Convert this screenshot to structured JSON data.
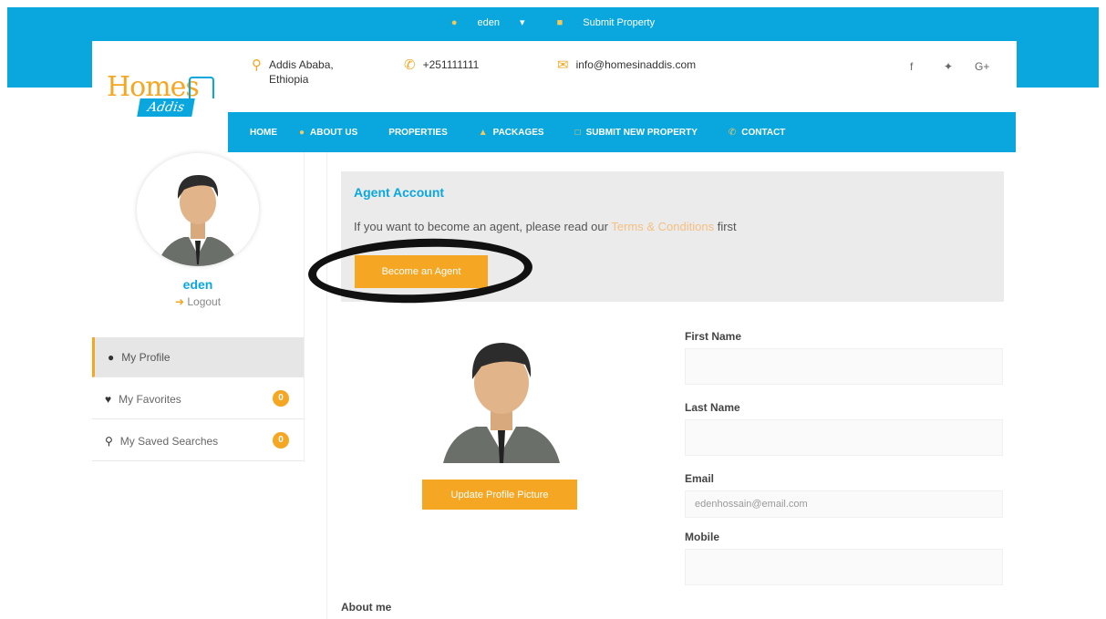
{
  "topbar": {
    "user": "eden",
    "submit": "Submit Property"
  },
  "header": {
    "logo_top": "Homes",
    "logo_bottom": "Addis",
    "address_line1": "Addis Ababa,",
    "address_line2": "Ethiopia",
    "phone": "+251111111",
    "email": "info@homesinaddis.com",
    "social": [
      "f",
      "❤",
      "G+"
    ]
  },
  "nav": {
    "items": [
      "HOME",
      "ABOUT US",
      "PROPERTIES",
      "PACKAGES",
      "SUBMIT NEW PROPERTY",
      "CONTACT"
    ]
  },
  "sidebar": {
    "username": "eden",
    "logout": "Logout",
    "items": [
      {
        "label": "My Profile"
      },
      {
        "label": "My Favorites",
        "count": "0"
      },
      {
        "label": "My Saved Searches",
        "count": "0"
      }
    ]
  },
  "agent": {
    "title": "Agent Account",
    "text_before": "If you want to become an agent, please read our",
    "link": "Terms & Conditions",
    "text_after": "first",
    "button": "Become an Agent"
  },
  "profile": {
    "update_button": "Update Profile Picture",
    "first_name_label": "First Name",
    "last_name_label": "Last Name",
    "email_label": "Email",
    "email_value": "edenhossain@email.com",
    "mobile_label": "Mobile",
    "about_label": "About me"
  },
  "colors": {
    "brand_blue": "#0aa7df",
    "accent_orange": "#f5a623"
  }
}
